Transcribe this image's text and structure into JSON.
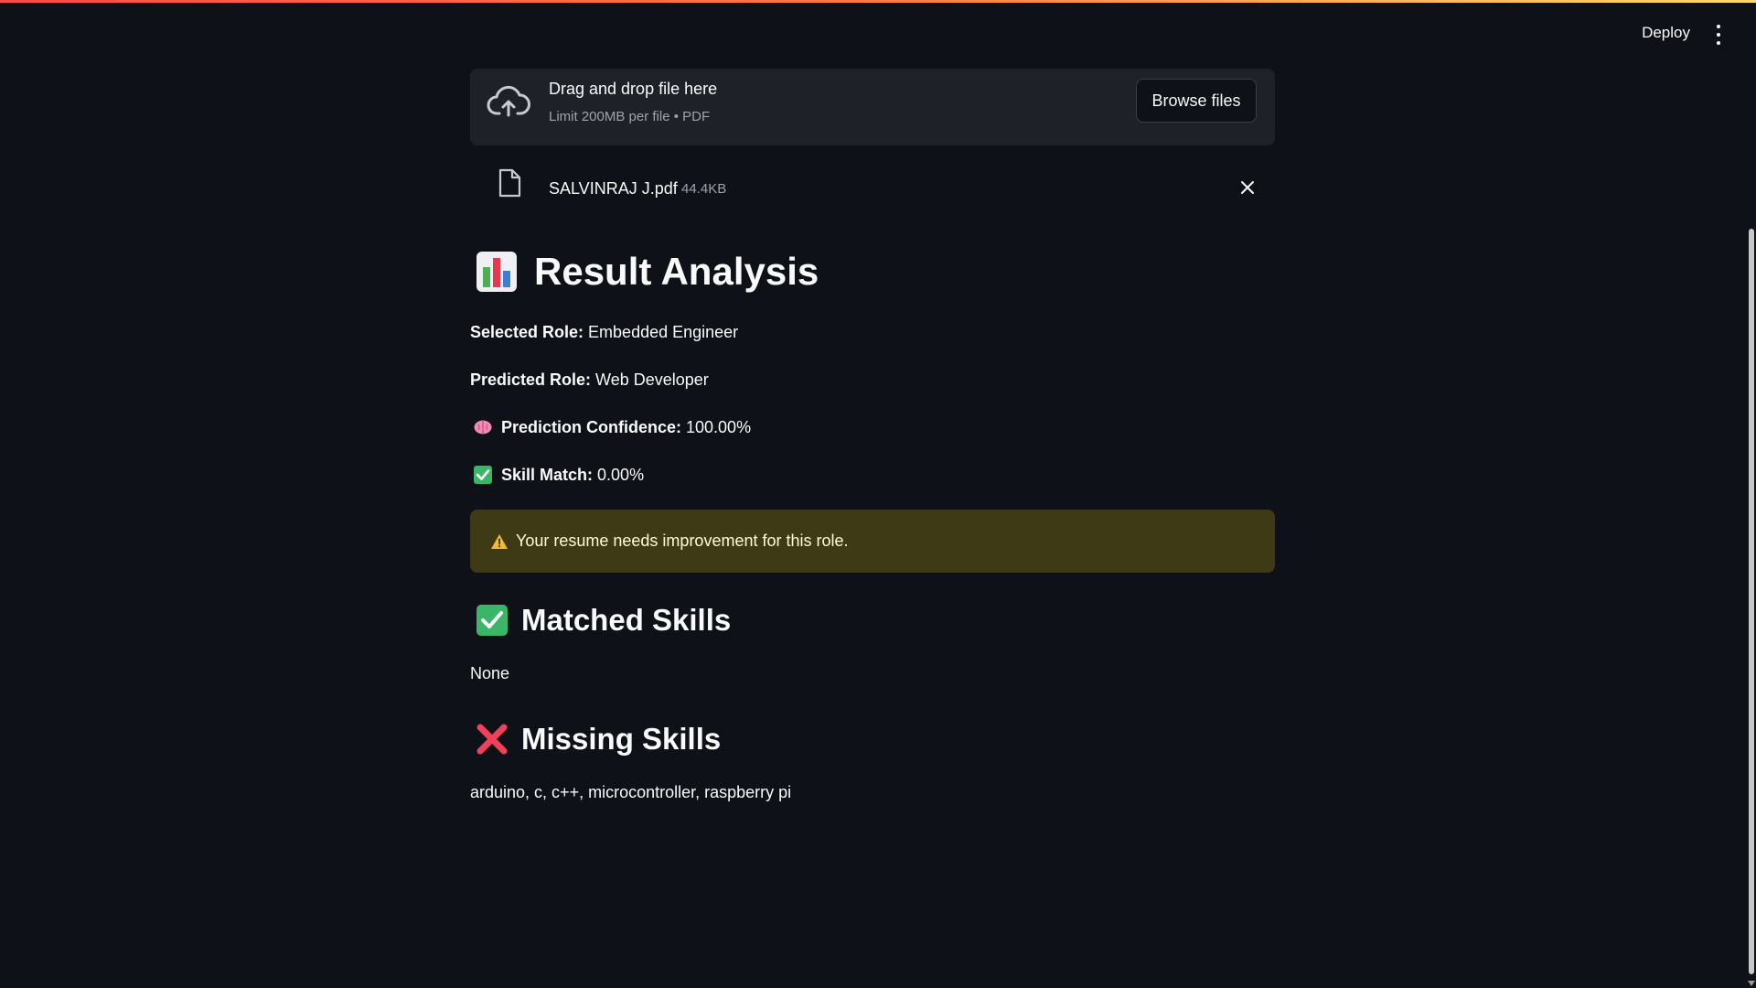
{
  "header": {
    "deploy_label": "Deploy",
    "menu_icon": "kebab-menu-icon"
  },
  "uploader": {
    "title": "Drag and drop file here",
    "subtitle": "Limit 200MB per file • PDF",
    "browse_label": "Browse files",
    "icon": "cloud-upload-icon"
  },
  "file": {
    "name": "SALVINRAJ J.pdf",
    "size": "44.4KB",
    "icon": "file-icon"
  },
  "result": {
    "title": "Result Analysis",
    "selected_role_label": "Selected Role:",
    "selected_role_value": "Embedded Engineer",
    "predicted_role_label": "Predicted Role:",
    "predicted_role_value": "Web Developer",
    "confidence_label": "Prediction Confidence:",
    "confidence_value": "100.00%",
    "skill_match_label": "Skill Match:",
    "skill_match_value": "0.00%",
    "warning": "Your resume needs improvement for this role."
  },
  "matched": {
    "title": "Matched Skills",
    "value": "None"
  },
  "missing": {
    "title": "Missing Skills",
    "value": "arduino, c, c++, microcontroller, raspberry pi"
  },
  "colors": {
    "background": "#0e1117",
    "dropzone": "#1f2129",
    "warning_bg": "#3d3a15",
    "warning_text": "#fffcd9",
    "accent_red": "#ff4b4b"
  }
}
